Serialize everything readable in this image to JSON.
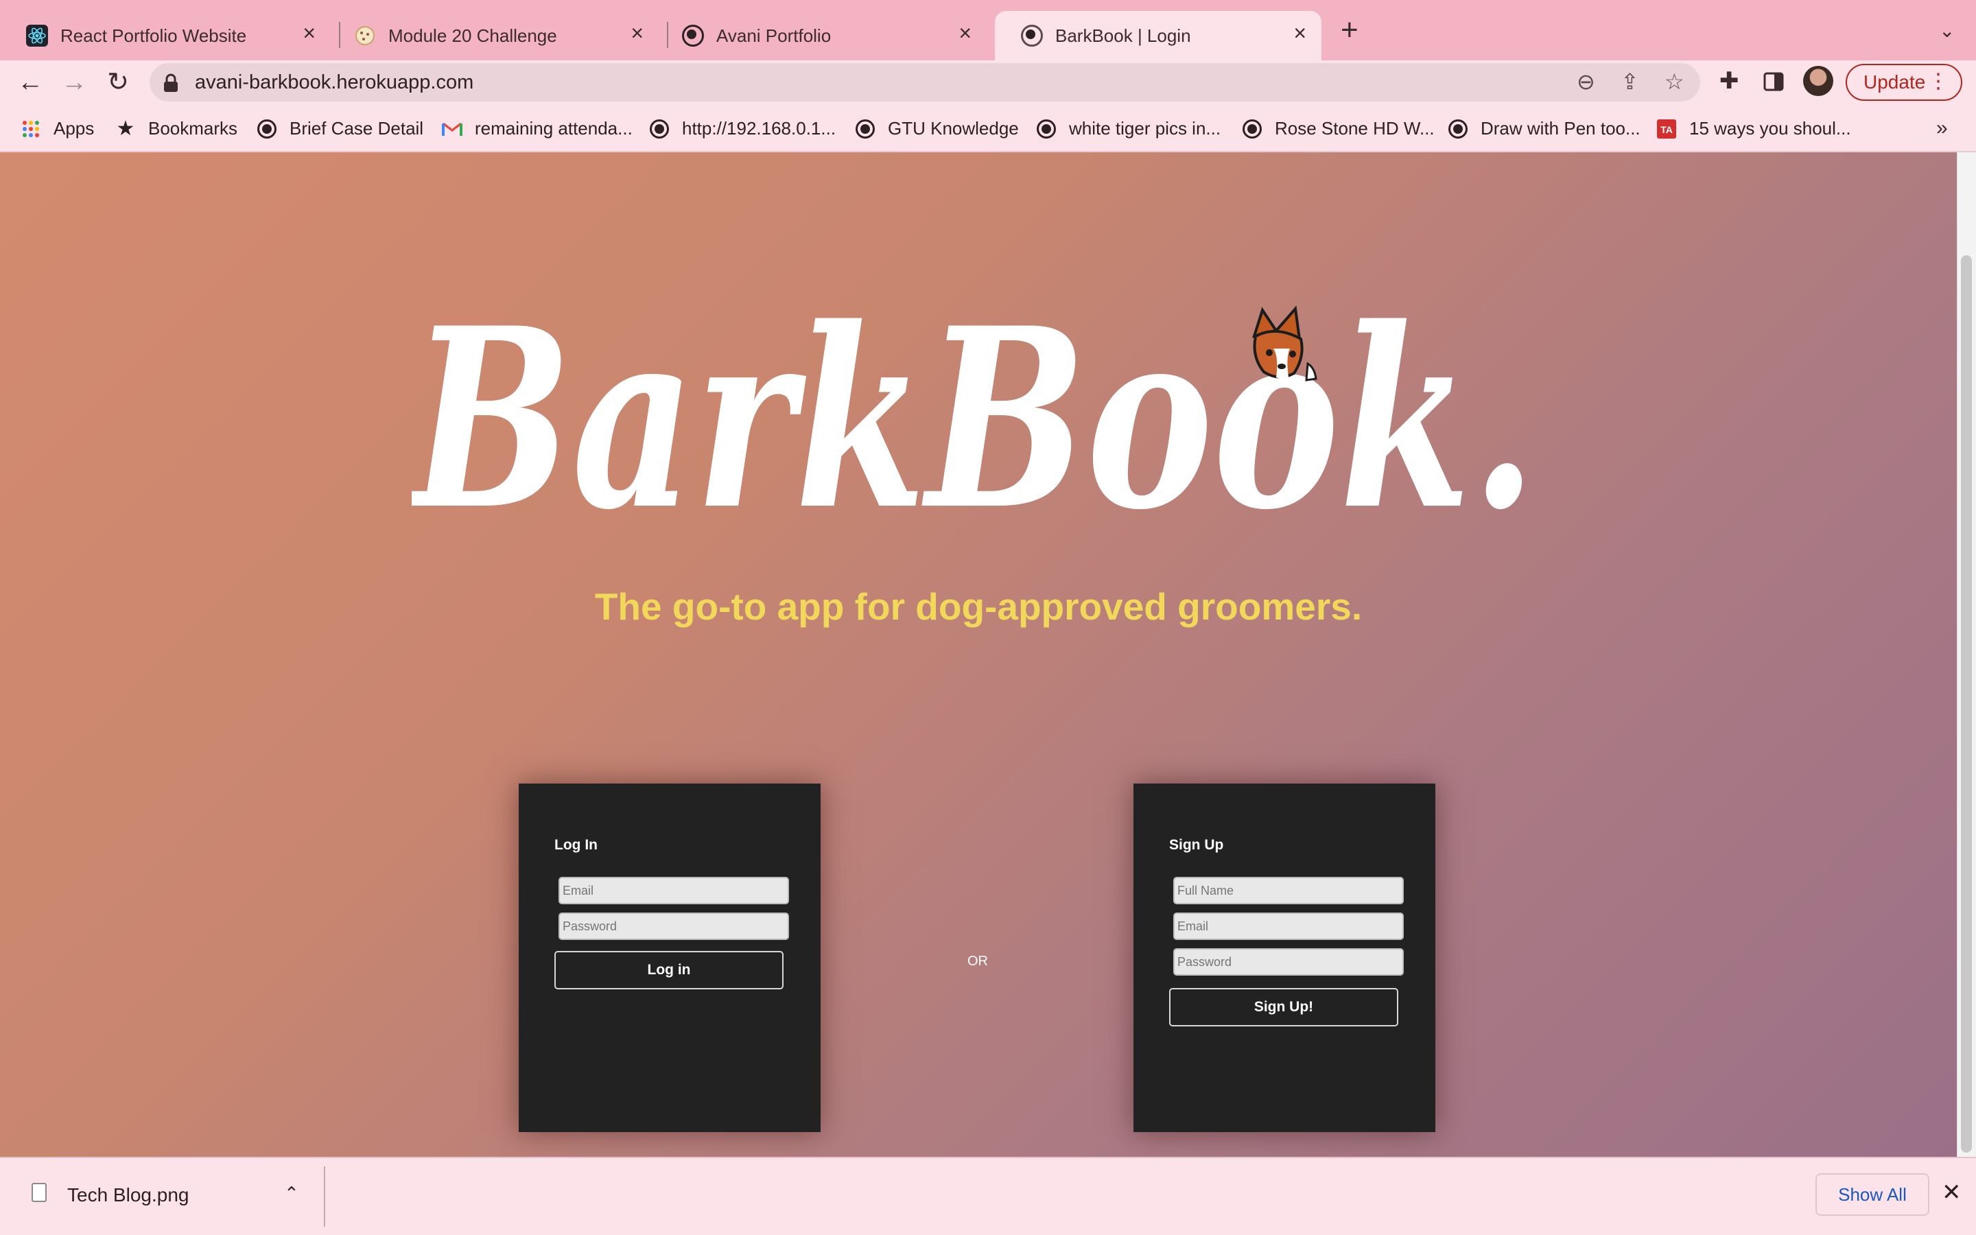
{
  "tabs": [
    {
      "title": "React Portfolio Website",
      "icon": "react-icon",
      "active": false
    },
    {
      "title": "Module 20 Challenge",
      "icon": "cookie-icon",
      "active": false
    },
    {
      "title": "Avani Portfolio",
      "icon": "globe-icon",
      "active": false
    },
    {
      "title": "BarkBook | Login",
      "icon": "globe-icon",
      "active": true
    }
  ],
  "toolbar": {
    "url": "avani-barkbook.herokuapp.com",
    "update_label": "Update"
  },
  "bookmarks": {
    "items": [
      {
        "label": "Apps",
        "icon": "apps-grid-icon"
      },
      {
        "label": "Bookmarks",
        "icon": "star-icon"
      },
      {
        "label": "Brief Case Detail",
        "icon": "globe-icon"
      },
      {
        "label": "remaining attenda...",
        "icon": "gmail-icon"
      },
      {
        "label": "http://192.168.0.1...",
        "icon": "globe-icon"
      },
      {
        "label": "GTU Knowledge",
        "icon": "globe-icon"
      },
      {
        "label": "white tiger pics in...",
        "icon": "globe-icon"
      },
      {
        "label": "Rose Stone HD W...",
        "icon": "globe-icon"
      },
      {
        "label": "Draw with Pen too...",
        "icon": "globe-icon"
      },
      {
        "label": "15 ways you shoul...",
        "icon": "ta-icon"
      }
    ]
  },
  "page": {
    "logo_text": "BarkBook.",
    "tagline": "The go-to app for dog-approved groomers.",
    "or_text": "OR",
    "tagline_color": "#f1d75a"
  },
  "login": {
    "heading": "Log In",
    "email_placeholder": "Email",
    "password_placeholder": "Password",
    "button_label": "Log in"
  },
  "signup": {
    "heading": "Sign Up",
    "fullname_placeholder": "Full Name",
    "email_placeholder": "Email",
    "password_placeholder": "Password",
    "button_label": "Sign Up!"
  },
  "downloads": {
    "file_name": "Tech Blog.png",
    "show_all_label": "Show All"
  }
}
